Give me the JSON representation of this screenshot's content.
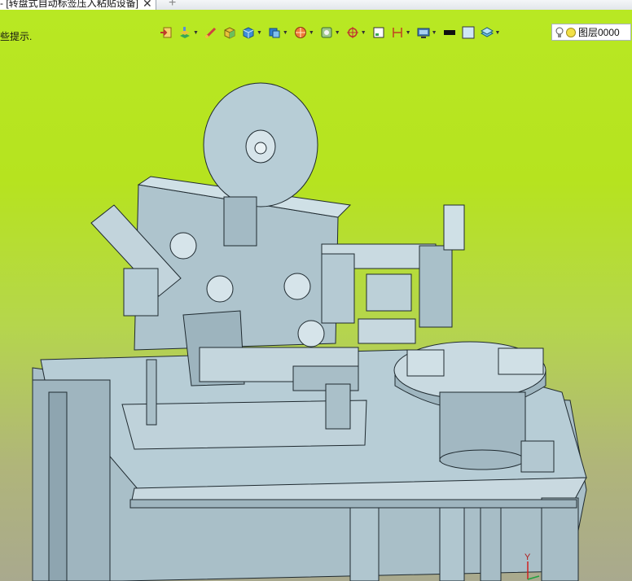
{
  "tab": {
    "title": "- [转盘式自动标签压入粘贴设备]",
    "close": "✕",
    "new_tab": "+"
  },
  "prompt": {
    "text": "些提示."
  },
  "toolbar": {
    "icons": [
      "exit-sketch-icon",
      "layer-tools-icon",
      "measure-icon",
      "box-solid-icon",
      "cube-icon",
      "view-cube-icon",
      "render-sphere-icon",
      "view-orient-icon",
      "snap-target-icon",
      "frame-icon",
      "dimension-icon",
      "display-mode-icon",
      "color-swatch-icon",
      "fill-swatch-icon",
      "layer-stack-icon"
    ],
    "colors": {
      "line_color": "#111111",
      "fill_color": "#cfe7f5"
    }
  },
  "layer": {
    "label": "图层0000"
  },
  "triad": {
    "y_label": "Y"
  },
  "colors": {
    "background_top": "#b8e823",
    "background_bottom": "#a9a98e",
    "model_fill": "#b7cdd6",
    "model_edge": "#1f2a30"
  }
}
